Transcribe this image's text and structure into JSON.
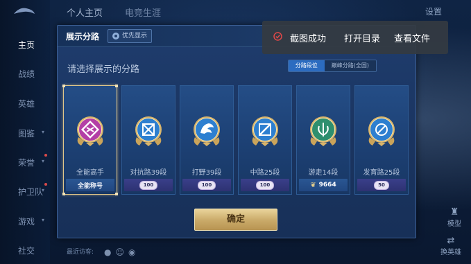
{
  "top": {
    "tabs": [
      "个人主页",
      "电竞生涯"
    ],
    "right_label": "设置"
  },
  "leftnav": {
    "items": [
      {
        "label": "主页",
        "active": true
      },
      {
        "label": "战绩",
        "active": false
      },
      {
        "label": "英雄",
        "active": false
      },
      {
        "label": "图鉴",
        "active": false
      },
      {
        "label": "荣誉",
        "active": false
      },
      {
        "label": "护卫队",
        "active": false
      },
      {
        "label": "游戏",
        "active": false
      },
      {
        "label": "社交",
        "active": false
      }
    ]
  },
  "right_side": {
    "label_top": "模型",
    "label_bottom": "换英雄"
  },
  "bottom": {
    "chat_hint": "最近访客:"
  },
  "dialog": {
    "title": "展示分路",
    "priority_button": "优先显示",
    "prompt": "请选择展示的分路",
    "segments": [
      {
        "label": "分路段位",
        "active": true
      },
      {
        "label": "巅峰分路(全国)",
        "active": false
      }
    ],
    "cards": [
      {
        "label": "全能高手",
        "foot_type": "title",
        "foot_text": "全能称号",
        "selected": true,
        "badge_color": "#b33fa6",
        "icon": "allrounder-icon"
      },
      {
        "label": "对抗路39段",
        "foot_type": "score",
        "foot_text": "100",
        "selected": false,
        "badge_color": "#2d7fd0",
        "icon": "clash-lane-icon"
      },
      {
        "label": "打野39段",
        "foot_type": "score",
        "foot_text": "100",
        "selected": false,
        "badge_color": "#2d7fd0",
        "icon": "jungle-icon"
      },
      {
        "label": "中路25段",
        "foot_type": "score",
        "foot_text": "100",
        "selected": false,
        "badge_color": "#2d7fd0",
        "icon": "mid-lane-icon"
      },
      {
        "label": "游走14段",
        "foot_type": "wing",
        "foot_text": "9664",
        "selected": false,
        "badge_color": "#2e8f6e",
        "icon": "roam-icon"
      },
      {
        "label": "发育路25段",
        "foot_type": "score",
        "foot_text": "50",
        "selected": false,
        "badge_color": "#2d7fd0",
        "icon": "farm-lane-icon"
      }
    ],
    "confirm_label": "确定"
  },
  "toast": {
    "message": "截图成功",
    "open_dir": "打开目录",
    "view_file": "查看文件",
    "accent": "#e04848"
  }
}
